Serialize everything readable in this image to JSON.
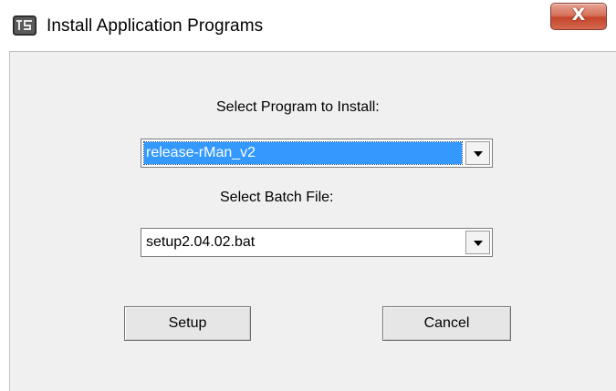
{
  "window": {
    "title": "Install Application Programs",
    "app_icon": "install-app-icon",
    "close_icon": "close-icon",
    "close_glyph": "X"
  },
  "form": {
    "program_label": "Select Program to Install:",
    "program_selected": "release-rMan_v2",
    "batch_label": "Select Batch File:",
    "batch_selected": "setup2.04.02.bat"
  },
  "buttons": {
    "setup_label": "Setup",
    "cancel_label": "Cancel"
  },
  "colors": {
    "selection_highlight": "#3399ff",
    "close_button": "#c4452b",
    "client_background": "#f0f0f0"
  }
}
